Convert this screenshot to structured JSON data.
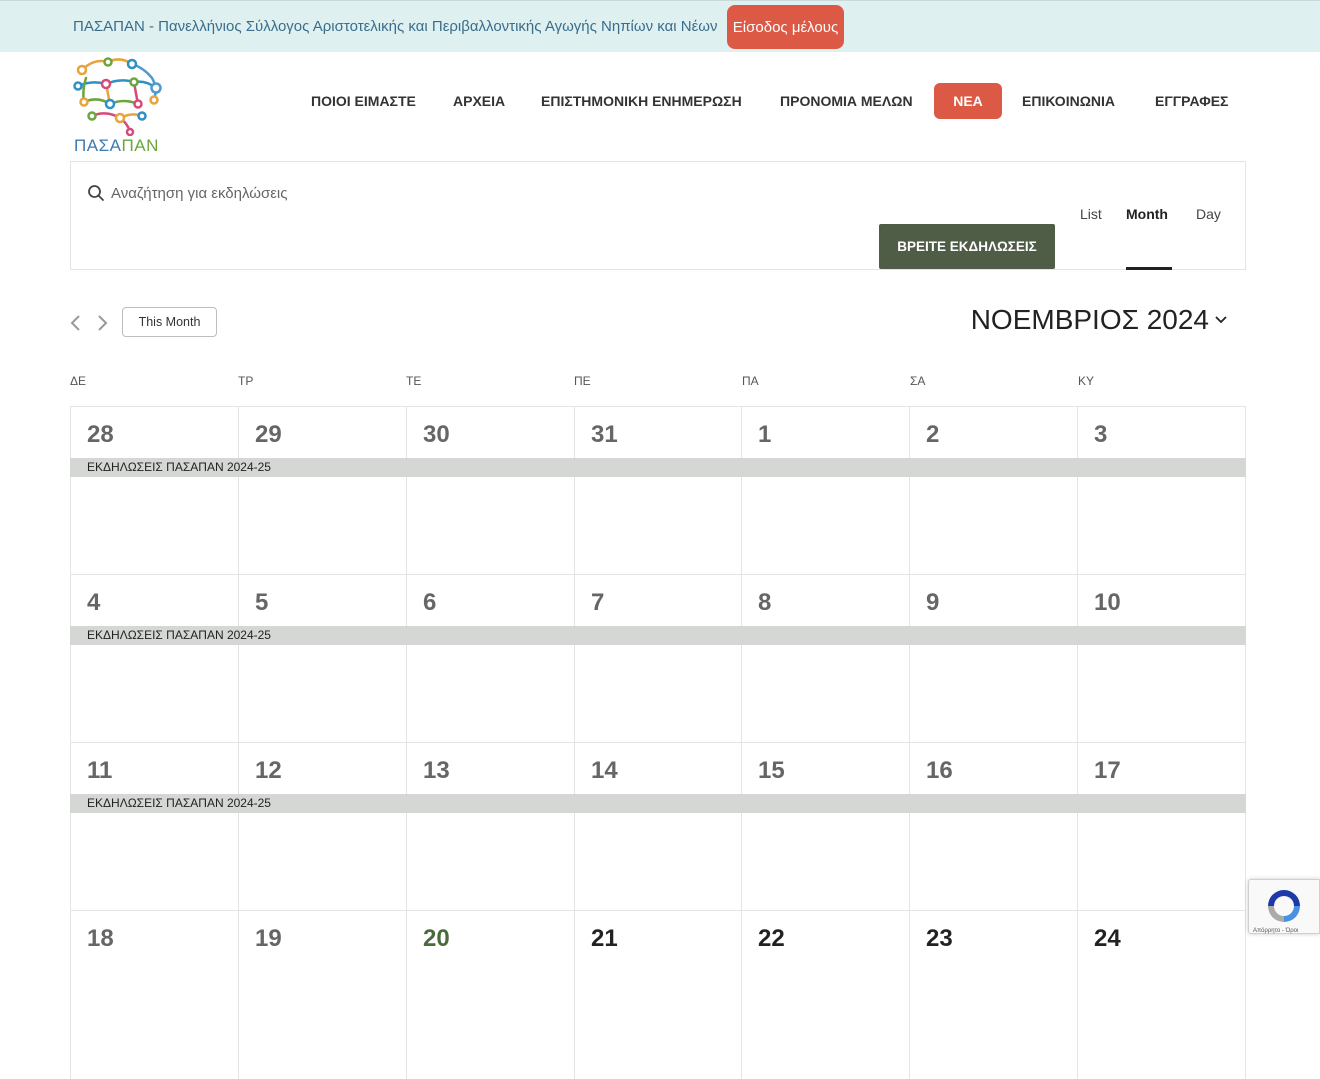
{
  "topbar": {
    "text": "ΠΑΣΑΠΑΝ - Πανελλήνιος Σύλλογος Αριστοτελικής και Περιβαλλοντικής Αγωγής Νηπίων και Νέων",
    "login_label": "Είσοδος μέλους"
  },
  "logo": {
    "text_a": "ΠΑΣΑ",
    "text_b": "ΠΑΝ"
  },
  "nav": [
    {
      "label": "ΠΟΙΟΙ ΕΙΜΑΣΤΕ"
    },
    {
      "label": "ΑΡΧΕΙΑ"
    },
    {
      "label": "ΕΠΙΣΤΗΜΟΝΙΚΗ ΕΝΗΜΕΡΩΣΗ"
    },
    {
      "label": "ΠΡΟΝΟΜΙΑ ΜΕΛΩΝ"
    },
    {
      "label": "ΝΕΑ"
    },
    {
      "label": "ΕΠΙΚΟΙΝΩΝΙΑ"
    },
    {
      "label": "ΕΓΓΡΑΦΕΣ"
    }
  ],
  "search": {
    "placeholder": "Αναζήτηση για εκδηλώσεις",
    "find_label": "ΒΡΕΙΤΕ ΕΚΔΗΛΩΣΕΙΣ"
  },
  "views": {
    "list": "List",
    "month": "Month",
    "day": "Day"
  },
  "calendar": {
    "this_month_label": "This Month",
    "month_title": "ΝΟΕΜΒΡΙΟΣ 2024",
    "weekdays": [
      "ΔΕ",
      "ΤΡ",
      "ΤΕ",
      "ΠΕ",
      "ΠΑ",
      "ΣΑ",
      "ΚΥ"
    ],
    "weeks": [
      {
        "days": [
          "28",
          "29",
          "30",
          "31",
          "1",
          "2",
          "3"
        ],
        "event": "ΕΚΔΗΛΩΣΕΙΣ ΠΑΣΑΠΑΝ 2024-25"
      },
      {
        "days": [
          "4",
          "5",
          "6",
          "7",
          "8",
          "9",
          "10"
        ],
        "event": "ΕΚΔΗΛΩΣΕΙΣ ΠΑΣΑΠΑΝ 2024-25"
      },
      {
        "days": [
          "11",
          "12",
          "13",
          "14",
          "15",
          "16",
          "17"
        ],
        "event": "ΕΚΔΗΛΩΣΕΙΣ ΠΑΣΑΠΑΝ 2024-25"
      },
      {
        "days": [
          "18",
          "19",
          "20",
          "21",
          "22",
          "23",
          "24"
        ],
        "event": ""
      }
    ]
  },
  "recaptcha": {
    "text": "Απόρρητο - Όροι"
  },
  "colors": {
    "accent": "#dc5a45",
    "find_button": "#4f5d46",
    "topbar_bg": "#dff0f0",
    "event_bar": "#d4d7d4"
  }
}
